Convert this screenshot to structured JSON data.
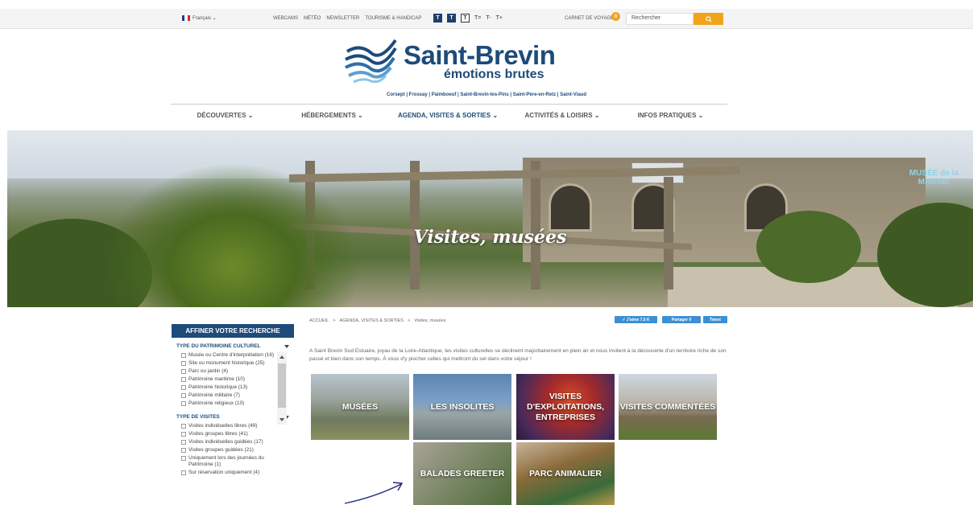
{
  "topbar": {
    "language": "Français ⌄",
    "links": [
      "WEBCAMS",
      "MÉTÉO",
      "NEWSLETTER",
      "TOURISME & HANDICAP"
    ],
    "a11y": [
      "T",
      "T",
      "T",
      "T=",
      "T-",
      "T+"
    ],
    "carnet_label": "CARNET DE VOYAGE",
    "carnet_count": "0",
    "search_placeholder": "Rechercher",
    "search_icon": "magnifier-icon",
    "colors": {
      "accent": "#f0a41c",
      "brand": "#1d4b7a"
    }
  },
  "logo": {
    "title": "Saint-Brevin",
    "slogan": "émotions brutes"
  },
  "towns": "Corsept | Frossay | Paimboeuf | Saint-Brevin-les-Pins | Saint-Père-en-Retz | Saint-Viaud",
  "nav": [
    {
      "label": "DÉCOUVERTES ⌄"
    },
    {
      "label": "HÉBERGEMENTS ⌄"
    },
    {
      "label": "AGENDA, VISITES & SORTIES ⌄"
    },
    {
      "label": "ACTIVITÉS & LOISIRS ⌄"
    },
    {
      "label": "INFOS PRATIQUES ⌄"
    }
  ],
  "hero": {
    "title": "Visites, musées",
    "sign": "MUSÉE de la MARINE"
  },
  "sidebar": {
    "title": "AFFINER VOTRE RECHERCHE",
    "groups": [
      {
        "title": "TYPE DU PATRIMOINE CULTUREL",
        "options": [
          "Musée ou Centre d'interprétation (16)",
          "Site ou monument historique (25)",
          "Parc ou jardin (4)",
          "Patrimoine maritime (10)",
          "Patrimoine historique (13)",
          "Patrimoine militaire (7)",
          "Patrimoine religieux (10)"
        ]
      },
      {
        "title": "TYPE DE VISITES",
        "options": [
          "Visites individuelles libres (49)",
          "Visites groupes libres (41)",
          "Visites individuelles guidées (17)",
          "Visites groupes guidées (21)",
          "Uniquement lors des journées du Patrimoine (1)",
          "Sur réservation uniquement (4)"
        ]
      }
    ]
  },
  "breadcrumb": [
    "ACCUEIL",
    ">",
    "AGENDA, VISITES & SORTIES",
    ">",
    "Visites, musées"
  ],
  "share": {
    "like": "✓ J'aime 7,6 K",
    "share": "Partager 0",
    "tweet": "Tweet"
  },
  "intro": "A Saint Brevin Sud Estuaire, joyau de la Loire-Atlantique, les visites culturelles se déclinent majoritairement en plein air et nous invitent à la découverte d'un territoire riche de son passé et bien dans son temps. À vous d'y piocher celles qui mettront du sel dans votre séjour !",
  "tiles": [
    {
      "label": "MUSÉES"
    },
    {
      "label": "LES INSOLITES"
    },
    {
      "label": "VISITES D'EXPLOITATIONS, ENTREPRISES"
    },
    {
      "label": "VISITES COMMENTÉES"
    },
    {
      "label": "BALADES GREETER"
    },
    {
      "label": "PARC ANIMALIER"
    }
  ]
}
